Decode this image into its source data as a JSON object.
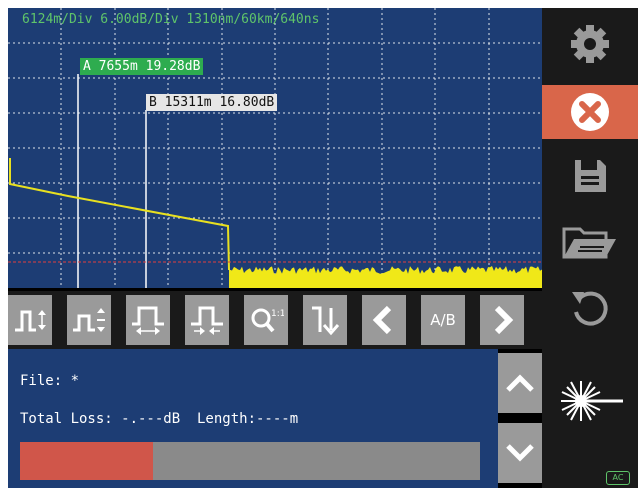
{
  "header": {
    "scale_text": "6124m/Div 6.00dB/Div 1310nm/60km/640ns"
  },
  "cursors": {
    "a_label": "A 7655m 19.28dB",
    "b_label": "B 15311m 16.80dB"
  },
  "trace": {
    "color": "#e8e020",
    "marker_line_color": "#e04040"
  },
  "toolbar": {
    "buttons": [
      {
        "icon": "vertical-zoom-icon"
      },
      {
        "icon": "vertical-shift-icon"
      },
      {
        "icon": "horizontal-zoom-out-icon"
      },
      {
        "icon": "horizontal-zoom-in-icon"
      },
      {
        "icon": "zoom-reset-icon"
      },
      {
        "icon": "event-marker-icon"
      },
      {
        "icon": "chevron-left-icon"
      },
      {
        "label": "A/B"
      },
      {
        "icon": "chevron-right-icon"
      }
    ]
  },
  "sidebar": {
    "items": [
      {
        "icon": "gear-icon"
      },
      {
        "icon": "close-icon",
        "active": true
      },
      {
        "icon": "save-icon"
      },
      {
        "icon": "folder-open-icon"
      },
      {
        "icon": "undo-icon"
      },
      {
        "icon": "laser-icon"
      }
    ]
  },
  "info": {
    "file_text": "File: *",
    "loss_text": "Total Loss: -.---dB  Length:----m",
    "progress_fraction": 0.29
  },
  "status": {
    "power_badge": "AC"
  },
  "colors": {
    "plot_bg": "#1d3d74",
    "button_gray": "#9a9a9a",
    "accent_red": "#d9664a",
    "text_green": "#5fc46a"
  }
}
